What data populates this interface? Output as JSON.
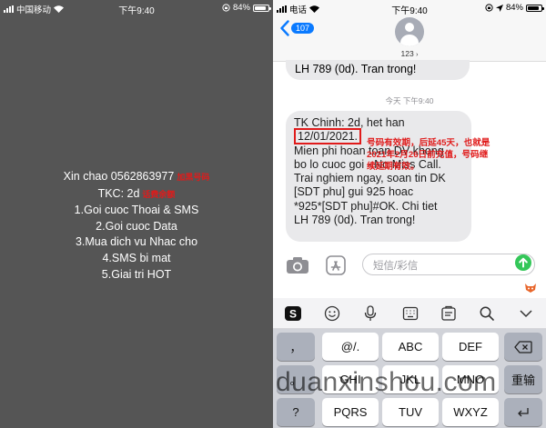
{
  "left_status": {
    "carrier": "中国移动",
    "time": "下午9:40",
    "battery": "84%",
    "battery_level": 0.84
  },
  "ussd": {
    "lines": [
      {
        "text": "Xin chao 0562863977",
        "note": "加黑号码"
      },
      {
        "text": "TKC: 2d",
        "note": "话费余额"
      },
      {
        "text": "1.Goi cuoc Thoai & SMS",
        "note": ""
      },
      {
        "text": "2.Goi cuoc Data",
        "note": ""
      },
      {
        "text": "3.Mua dich vu Nhac cho",
        "note": ""
      },
      {
        "text": "4.SMS bi mat",
        "note": ""
      },
      {
        "text": "5.Giai tri HOT",
        "note": ""
      }
    ]
  },
  "right_status": {
    "carrier": "电话",
    "time": "下午9:40",
    "battery": "84%",
    "battery_level": 0.84
  },
  "header": {
    "back_count": "107",
    "contact": "123"
  },
  "messages": {
    "previous_tail": "LH 789 (0d). Tran trong!",
    "timestamp": "今天 下午9:40",
    "bubble": {
      "line1": "TK Chinh: 2d, het han",
      "date": "12/01/2021.",
      "rest": [
        "Mien phi hoan toan DV khong",
        "bo lo cuoc goi - No Miss Call.",
        "Trai nghiem ngay, soan tin DK",
        "[SDT phu] gui 925 hoac",
        "*925*[SDT phu]#OK. Chi tiet",
        "LH 789 (0d). Tran trong!"
      ]
    },
    "annotation": [
      "号码有效期，后延45天，也就是",
      "2021年2月26日前充值，号码继",
      "续延期有效。"
    ]
  },
  "composer": {
    "placeholder": "短信/彩信"
  },
  "keyboard": {
    "row1": [
      "，",
      "@/.",
      "ABC",
      "DEF",
      "⌫"
    ],
    "row2": [
      "。",
      "GHI",
      "JKL",
      "MNO",
      "重输"
    ],
    "row3": [
      "?",
      "PQRS",
      "TUV",
      "WXYZ",
      ""
    ]
  },
  "watermark": "duanxinshou.com"
}
